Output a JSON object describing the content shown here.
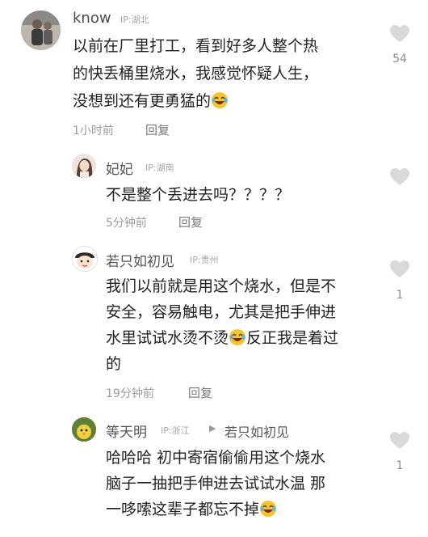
{
  "comments": [
    {
      "user": "know",
      "ip": "IP:湖北",
      "lines": [
        "以前在厂里打工，看到好多人整个热",
        "的快丢桶里烧水，我感觉怀疑人生，",
        "没想到还有更勇猛的"
      ],
      "time": "1小时前",
      "reply": "回复",
      "likes": "54",
      "avatar_icon": "person-photo-avatar"
    },
    {
      "user": "妃妃",
      "ip": "IP:湖南",
      "lines": [
        "不是整个丢进去吗？？？？"
      ],
      "time": "5分钟前",
      "reply": "回复",
      "likes": "",
      "avatar_icon": "woman-photo-avatar"
    },
    {
      "user": "若只如初见",
      "ip": "IP:贵州",
      "lines": [
        "我们以前就是用这个烧水，但是不",
        "安全，容易触电，尤其是把手伸进",
        "水里试试水烫不烫",
        "的"
      ],
      "line3_tail": "反正我是着过",
      "time": "19分钟前",
      "reply": "回复",
      "likes": "1",
      "avatar_icon": "cartoon-face-avatar"
    },
    {
      "user": "等天明",
      "ip": "IP:浙江",
      "reply_to": "若只如初见",
      "lines": [
        "哈哈哈  初中寄宿偷偷用这个烧水",
        "脑子一抽把手伸进去试试水温   那",
        "一哆嗦这辈子都忘不掉"
      ],
      "likes": "1",
      "avatar_icon": "cartoon-bird-avatar"
    }
  ],
  "colors": {
    "heart": "#d9d9d9",
    "text": "#222222",
    "meta": "#9b9b9b",
    "emoji": "#f7c331"
  }
}
